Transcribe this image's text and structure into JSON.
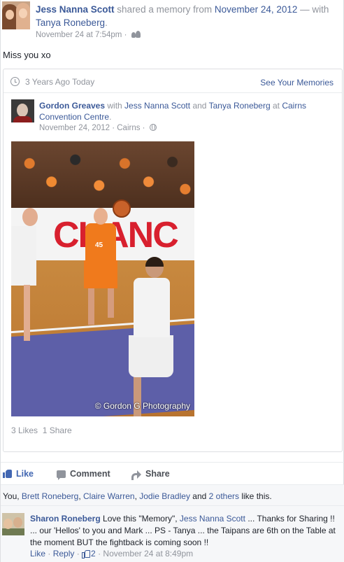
{
  "header": {
    "author": "Jess Nanna Scott",
    "shared_text": " shared a memory from ",
    "date_link": "November 24, 2012",
    "with_text": " — with ",
    "tagged": "Tanya Roneberg",
    "period": ".",
    "timestamp": "November 24 at 7:54pm",
    "sep": " · ",
    "audience_icon": "friends-icon"
  },
  "status_text": "Miss you xo",
  "memory": {
    "years_ago": "3 Years Ago Today",
    "see_memories": "See Your Memories",
    "original": {
      "author": "Gordon Greaves",
      "with_text": " with ",
      "tagged1": "Jess Nanna Scott",
      "and_text": " and ",
      "tagged2": "Tanya Roneberg",
      "at_text": " at ",
      "place": "Cairns Convention Centre",
      "period": ".",
      "date": "November 24, 2012",
      "sep": " · ",
      "city": "Cairns",
      "sep2": " · ",
      "audience_icon": "globe-icon"
    },
    "photo": {
      "banner_text": "CHANC",
      "jersey_number": "45",
      "watermark": "© Gordon G Photography"
    },
    "likes": "3 Likes",
    "shares": "1 Share"
  },
  "actions": {
    "like": "Like",
    "comment": "Comment",
    "share": "Share"
  },
  "likes_line": {
    "prefix": "You, ",
    "n1": "Brett Roneberg",
    "c1": ", ",
    "n2": "Claire Warren",
    "c2": ", ",
    "n3": "Jodie Bradley",
    "and_text": " and ",
    "others": "2 others",
    "suffix": " like this."
  },
  "comment": {
    "author": "Sharon Roneberg",
    "text1": " Love this \"Memory\", ",
    "mention": "Jess Nanna Scott",
    "text2": " ... Thanks for Sharing !! ... our 'Hellos' to you and Mark ... PS - Tanya ... the Taipans are 6th on the Table at the moment BUT the fightback is coming soon !!",
    "like": "Like",
    "reply": "Reply",
    "like_count": "2",
    "timestamp": "November 24 at 8:49pm",
    "sep": " · "
  },
  "colors": {
    "link": "#3b5998",
    "muted": "#90949c",
    "like_blue": "#4267b2"
  }
}
